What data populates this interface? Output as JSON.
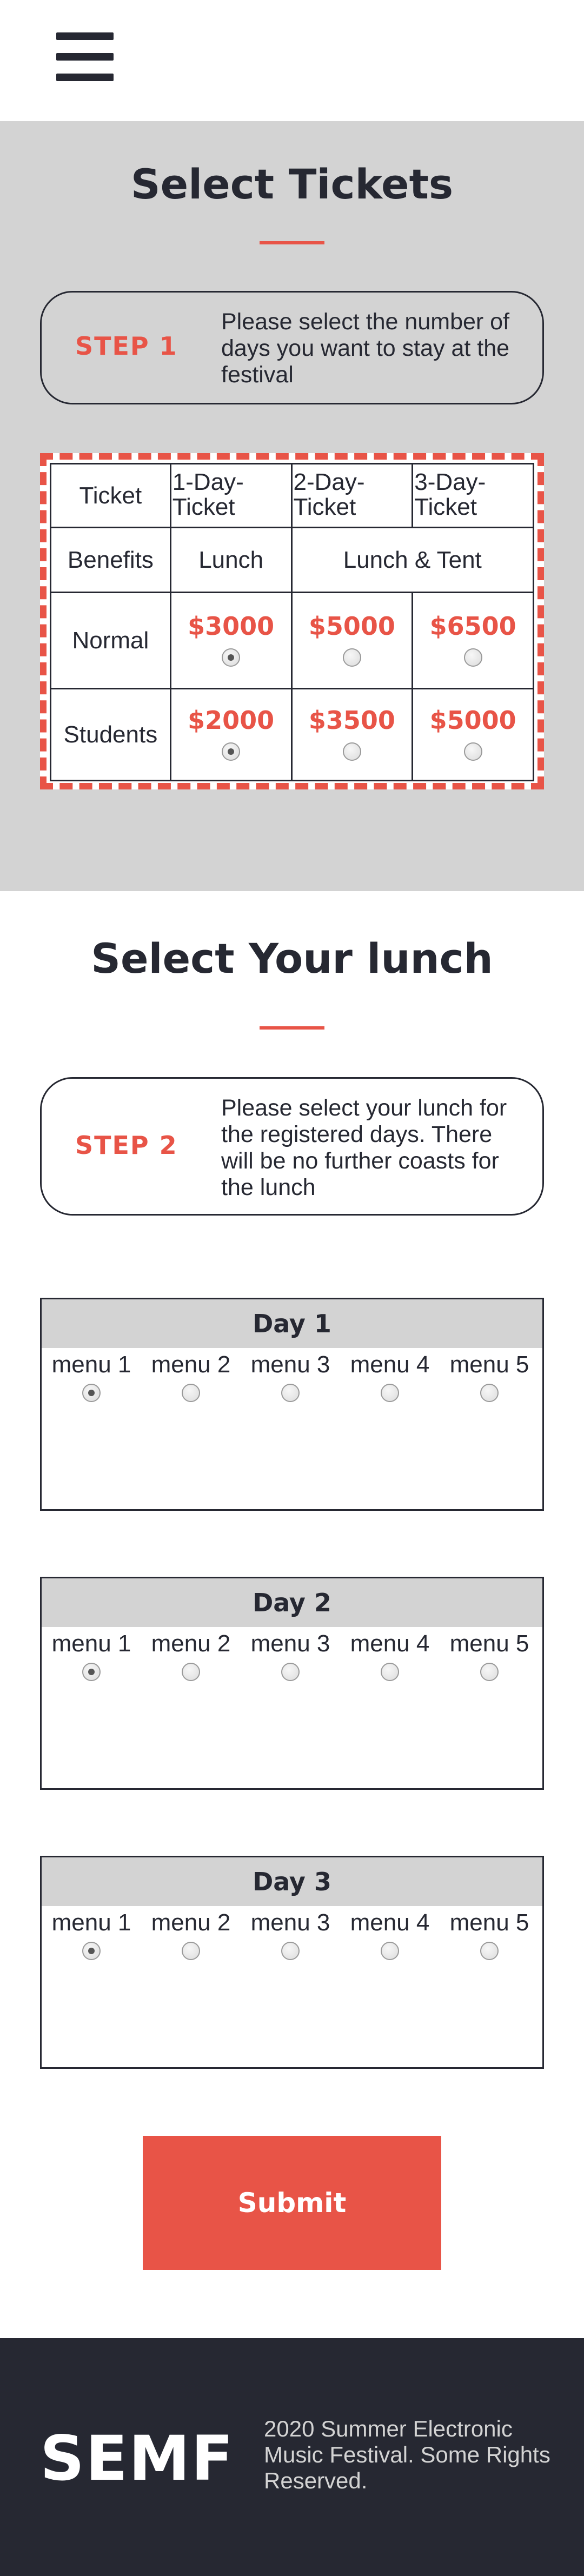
{
  "header": {
    "menu_icon": "hamburger-menu-icon"
  },
  "tickets": {
    "title": "Select Tickets",
    "step_label": "STEP 1",
    "step_text": "Please select the number of days you want to stay at the festival",
    "table": {
      "corner": "Ticket",
      "columns": [
        "1-Day-Ticket",
        "2-Day-Ticket",
        "3-Day-Ticket"
      ],
      "benefits_label": "Benefits",
      "benefits": [
        "Lunch",
        "Lunch & Tent"
      ],
      "rows": [
        {
          "label": "Normal",
          "prices": [
            "$3000",
            "$5000",
            "$6500"
          ],
          "selected": 0
        },
        {
          "label": "Students",
          "prices": [
            "$2000",
            "$3500",
            "$5000"
          ],
          "selected": 0
        }
      ]
    }
  },
  "lunch": {
    "title": "Select Your lunch",
    "step_label": "STEP 2",
    "step_text": "Please select your lunch for the registered days. There will be no further coasts for the lunch",
    "days": [
      {
        "title": "Day 1",
        "menus": [
          "menu 1",
          "menu 2",
          "menu 3",
          "menu 4",
          "menu 5"
        ],
        "selected": 0
      },
      {
        "title": "Day 2",
        "menus": [
          "menu 1",
          "menu 2",
          "menu 3",
          "menu 4",
          "menu 5"
        ],
        "selected": 0
      },
      {
        "title": "Day 3",
        "menus": [
          "menu 1",
          "menu 2",
          "menu 3",
          "menu 4",
          "menu 5"
        ],
        "selected": 0
      }
    ],
    "submit_label": "Submit"
  },
  "footer": {
    "logo": "SEMF",
    "copyright": "2020 Summer Electronic Music Festival. Some Rights Reserved."
  },
  "colors": {
    "accent": "#e85447",
    "dark": "#262832",
    "gray": "#d3d3d3"
  }
}
